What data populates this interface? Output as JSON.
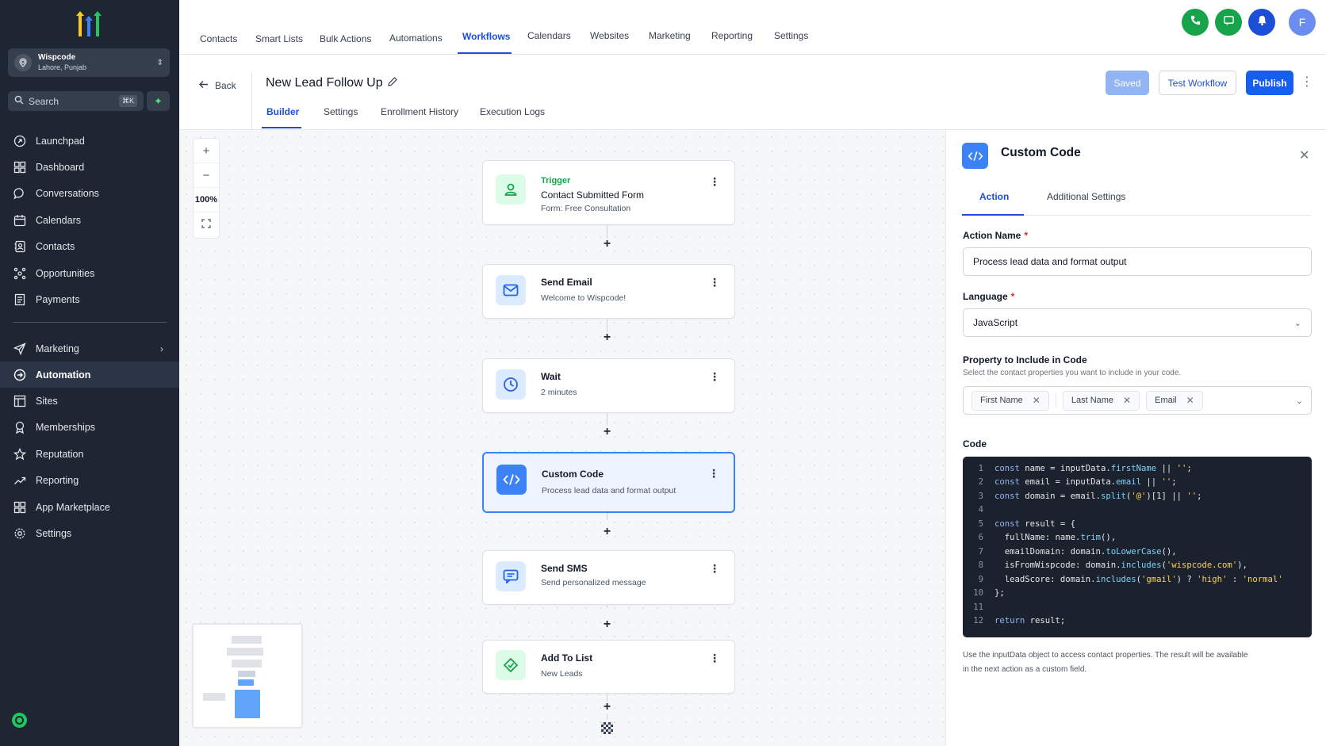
{
  "sidebar": {
    "account": {
      "name": "Wispcode",
      "location": "Lahore, Punjab"
    },
    "search": {
      "placeholder": "Search",
      "shortcut": "⌘K"
    },
    "items_top": [
      {
        "label": "Launchpad",
        "icon": "launchpad-icon"
      },
      {
        "label": "Dashboard",
        "icon": "dashboard-icon"
      },
      {
        "label": "Conversations",
        "icon": "chat-bubble-icon"
      },
      {
        "label": "Calendars",
        "icon": "calendar-icon"
      },
      {
        "label": "Contacts",
        "icon": "contacts-icon"
      },
      {
        "label": "Opportunities",
        "icon": "opportunities-icon"
      },
      {
        "label": "Payments",
        "icon": "payments-icon"
      }
    ],
    "items_bottom": [
      {
        "label": "Marketing",
        "icon": "send-icon"
      },
      {
        "label": "Automation",
        "icon": "automation-icon",
        "active": true
      },
      {
        "label": "Sites",
        "icon": "sites-icon"
      },
      {
        "label": "Memberships",
        "icon": "membership-icon"
      },
      {
        "label": "Reputation",
        "icon": "star-icon"
      },
      {
        "label": "Reporting",
        "icon": "trend-icon"
      },
      {
        "label": "App Marketplace",
        "icon": "grid-icon"
      },
      {
        "label": "Settings",
        "icon": "gear-icon"
      }
    ]
  },
  "topnav": {
    "tabs": [
      "Contacts",
      "Smart Lists",
      "Bulk Actions",
      "Automations",
      "Workflows",
      "Calendars",
      "Websites",
      "Marketing",
      "Reporting",
      "Settings"
    ],
    "active_tab": "Workflows",
    "avatar_letter": "F",
    "colors": {
      "phone": "#16a34a",
      "message": "#16a34a",
      "bell": "#1d4ed8",
      "avatar": "#6b8df0"
    }
  },
  "header": {
    "back_label": "Back",
    "workflow_title": "New Lead Follow Up",
    "subtabs": [
      "Builder",
      "Settings",
      "Enrollment History",
      "Execution Logs"
    ],
    "active_subtab": "Builder",
    "saved_label": "Saved",
    "test_label": "Test Workflow",
    "publish_label": "Publish"
  },
  "canvas": {
    "zoom": "100%",
    "nodes": [
      {
        "kicker": "Trigger",
        "title": "Contact Submitted Form",
        "subtitle": "Form: Free Consultation",
        "icon": "person-icon"
      },
      {
        "title": "Send Email",
        "subtitle": "Welcome to Wispcode!",
        "icon": "mail-icon"
      },
      {
        "title": "Wait",
        "subtitle": "2 minutes",
        "icon": "clock-icon"
      },
      {
        "title": "Custom Code",
        "subtitle": "Process lead data and format output",
        "icon": "code-icon",
        "selected": true
      },
      {
        "title": "Send SMS",
        "subtitle": "Send personalized message",
        "icon": "sms-icon"
      },
      {
        "title": "Add To List",
        "subtitle": "New Leads",
        "icon": "tag-icon"
      }
    ]
  },
  "panel": {
    "title": "Custom Code",
    "tabs": [
      "Action",
      "Additional Settings"
    ],
    "active_tab": "Action",
    "action_name_label": "Action Name",
    "action_name_value": "Process lead data and format output",
    "language_label": "Language",
    "language_value": "JavaScript",
    "property_label": "Property to Include in Code",
    "property_hint": "Select the contact properties you want to include in your code.",
    "chips": [
      "First Name",
      "Last Name",
      "Email"
    ],
    "code_label": "Code",
    "code_lines": [
      "const name = inputData.firstName || '';",
      "const email = inputData.email || '';",
      "const domain = email.split('@')[1] || '';",
      "",
      "const result = {",
      "  fullName: name.trim(),",
      "  emailDomain: domain.toLowerCase(),",
      "  isFromWispcode: domain.includes('wispcode.com'),",
      "  leadScore: domain.includes('gmail') ? 'high' : 'normal'",
      "};",
      "",
      "return result;"
    ],
    "note": "Use the inputData object to access contact properties. The result will be available in the next action as a custom field."
  }
}
